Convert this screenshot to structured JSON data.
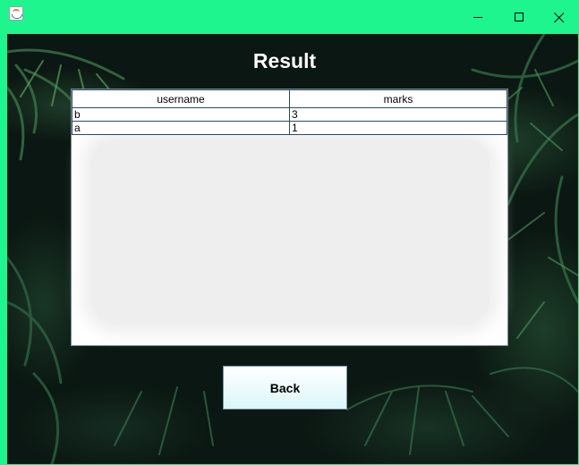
{
  "window": {
    "icon": "java-app-icon",
    "controls": {
      "minimize": "minimize-icon",
      "maximize": "maximize-icon",
      "close": "close-icon"
    },
    "title_bar_color": "#1ef58e"
  },
  "main": {
    "title": "Result",
    "table": {
      "columns": [
        "username",
        "marks"
      ],
      "rows": [
        [
          "b",
          "3"
        ],
        [
          "a",
          "1"
        ]
      ]
    },
    "back_button": "Back"
  }
}
